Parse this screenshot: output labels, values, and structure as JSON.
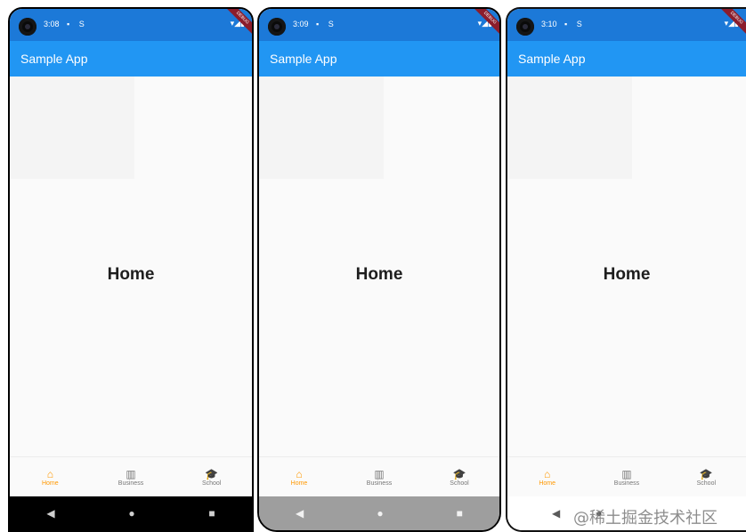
{
  "screens": [
    {
      "status_time": "3:08",
      "status_glyphs": "▪ S",
      "status_right": "▾◢▮",
      "debug_banner": "DEBUG",
      "app_title": "Sample App",
      "body_text": "Home",
      "nav": [
        {
          "icon": "home-icon",
          "glyph": "⌂",
          "label": "Home",
          "active": true
        },
        {
          "icon": "business-icon",
          "glyph": "▥",
          "label": "Business",
          "active": false
        },
        {
          "icon": "school-icon",
          "glyph": "🎓",
          "label": "School",
          "active": false
        }
      ],
      "sys_nav": [
        "◀",
        "●",
        "■"
      ]
    },
    {
      "status_time": "3:09",
      "status_glyphs": "▪ S",
      "status_right": "▾◢▮",
      "debug_banner": "DEBUG",
      "app_title": "Sample App",
      "body_text": "Home",
      "nav": [
        {
          "icon": "home-icon",
          "glyph": "⌂",
          "label": "Home",
          "active": true
        },
        {
          "icon": "business-icon",
          "glyph": "▥",
          "label": "Business",
          "active": false
        },
        {
          "icon": "school-icon",
          "glyph": "🎓",
          "label": "School",
          "active": false
        }
      ],
      "sys_nav": [
        "◀",
        "●",
        "■"
      ]
    },
    {
      "status_time": "3:10",
      "status_glyphs": "▪ S",
      "status_right": "▾◢▮",
      "debug_banner": "DEBUG",
      "app_title": "Sample App",
      "body_text": "Home",
      "nav": [
        {
          "icon": "home-icon",
          "glyph": "⌂",
          "label": "Home",
          "active": true
        },
        {
          "icon": "business-icon",
          "glyph": "▥",
          "label": "Business",
          "active": false
        },
        {
          "icon": "school-icon",
          "glyph": "🎓",
          "label": "School",
          "active": false
        }
      ],
      "sys_nav": [
        "◀",
        "●",
        "■"
      ]
    }
  ],
  "watermark": "@稀土掘金技术社区",
  "colors": {
    "status_bar": "#1c79d8",
    "app_bar": "#2196f3",
    "active_nav": "#ff9800",
    "inactive_nav": "#777777"
  }
}
